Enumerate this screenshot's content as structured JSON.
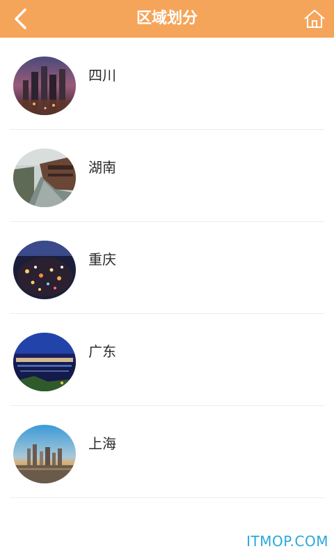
{
  "header": {
    "title": "区域划分",
    "back_icon": "chevron-left-icon",
    "home_icon": "home-icon",
    "background_color": "#f5a55a"
  },
  "regions": [
    {
      "label": "四川",
      "image": "city-skyline-dusk"
    },
    {
      "label": "湖南",
      "image": "riverside-town"
    },
    {
      "label": "重庆",
      "image": "city-night-lights"
    },
    {
      "label": "广东",
      "image": "night-waterfront"
    },
    {
      "label": "上海",
      "image": "skyline-over-water"
    }
  ],
  "watermark": "ITMOP.COM"
}
